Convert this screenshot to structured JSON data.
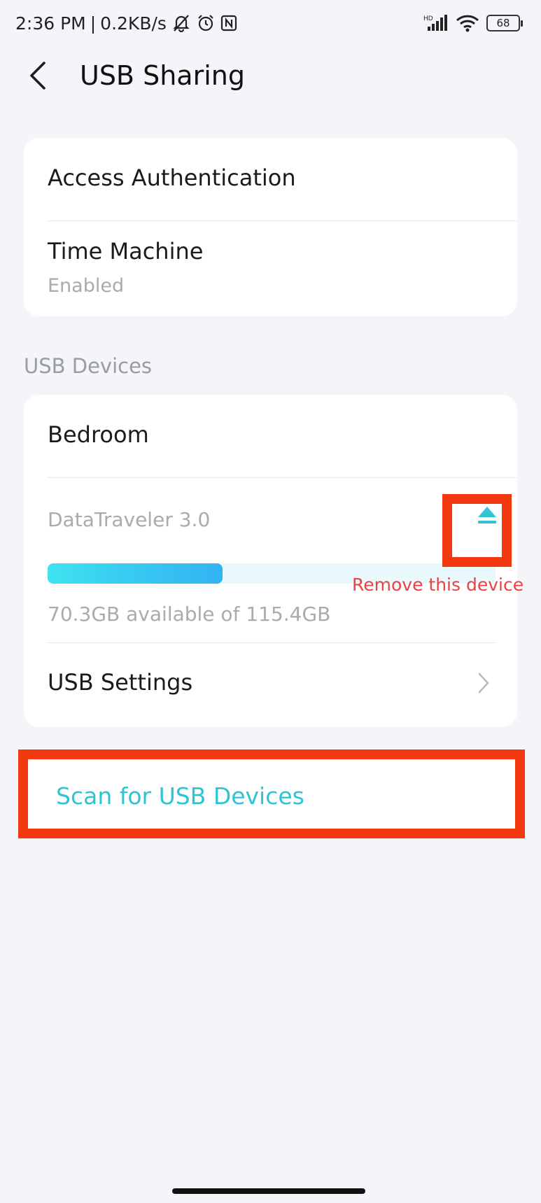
{
  "status_bar": {
    "time": "2:36 PM",
    "separator": "|",
    "speed": "0.2KB/s",
    "network_label": "HD",
    "battery": "68",
    "icons": [
      "muted-bell-icon",
      "alarm-icon",
      "nfc-icon",
      "signal-icon",
      "wifi-icon",
      "battery-icon"
    ]
  },
  "header": {
    "title": "USB Sharing",
    "back_icon": "chevron-left-icon"
  },
  "settings": {
    "access_auth": "Access Authentication",
    "time_machine": {
      "title": "Time Machine",
      "status": "Enabled"
    }
  },
  "usb_devices": {
    "section_label": "USB Devices",
    "router_name": "Bedroom",
    "device": {
      "name": "DataTraveler 3.0",
      "storage_text": "70.3GB available of 115.4GB",
      "used_fraction": 0.39,
      "eject_icon": "eject-icon"
    },
    "usb_settings": "USB Settings"
  },
  "annotations": {
    "eject_hint": "Remove this device"
  },
  "scan": {
    "label": "Scan for USB Devices"
  },
  "colors": {
    "accent": "#2ec5d3",
    "highlight": "#f2380f",
    "hint_text": "#e84242",
    "background": "#f4f5f9"
  }
}
